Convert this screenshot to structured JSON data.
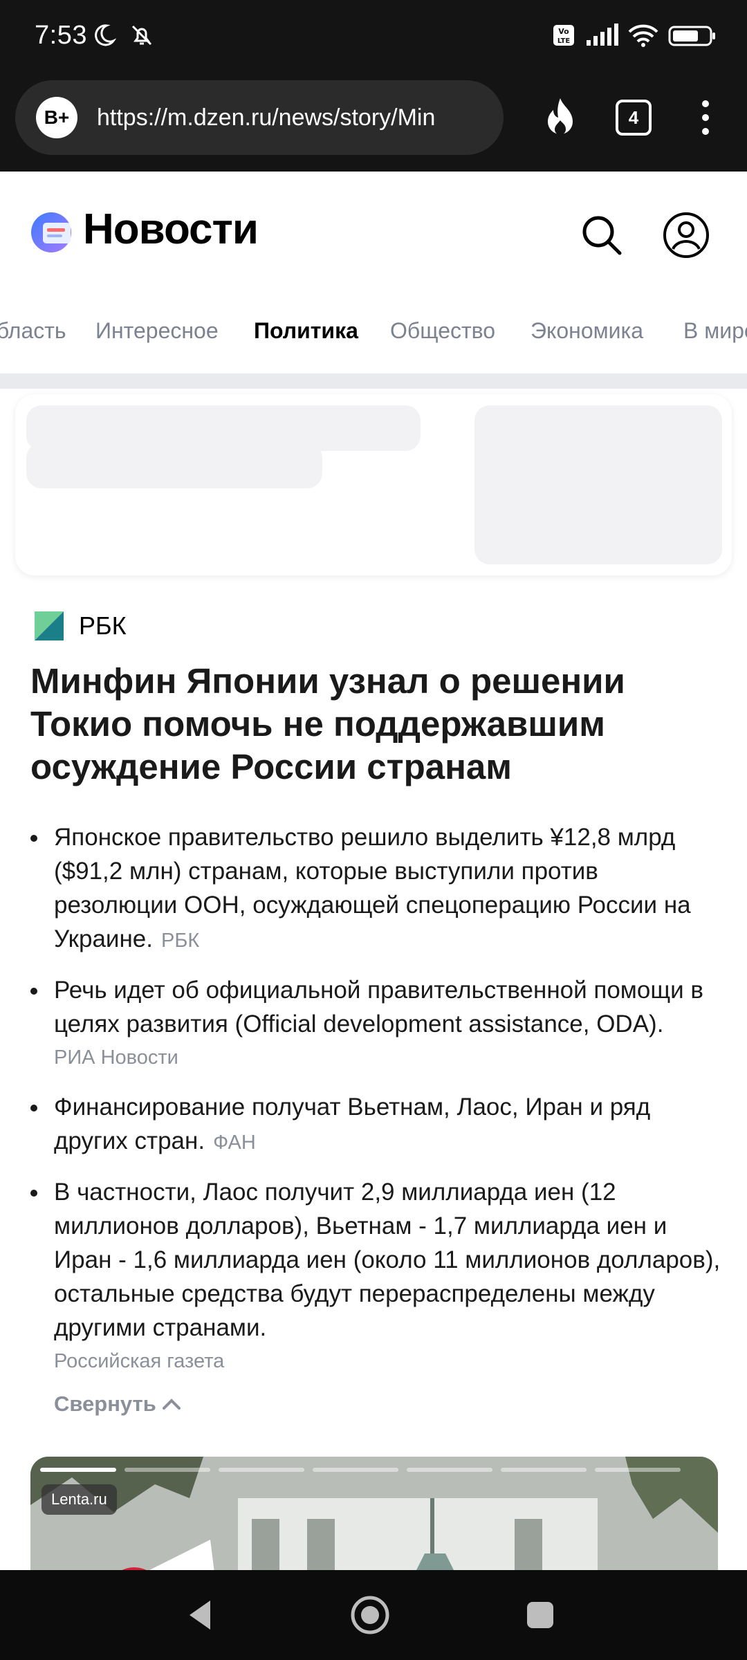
{
  "status_bar": {
    "time": "7:53",
    "icons": [
      "moon-icon",
      "bell-off-icon",
      "volte-icon",
      "signal-icon",
      "wifi-icon",
      "battery-icon"
    ]
  },
  "browser": {
    "profile_badge": "B+",
    "url": "https://m.dzen.ru/news/story/Min",
    "tab_count": "4"
  },
  "header": {
    "title": "Новости"
  },
  "tabs": [
    {
      "label": "Область",
      "active": false
    },
    {
      "label": "Интересное",
      "active": false
    },
    {
      "label": "Политика",
      "active": true
    },
    {
      "label": "Общество",
      "active": false
    },
    {
      "label": "Экономика",
      "active": false
    },
    {
      "label": "В мире",
      "active": false
    }
  ],
  "article": {
    "source": "РБК",
    "headline": "Минфин Японии узнал о решении Токио помочь не поддержавшим осуждение России странам",
    "bullets": [
      {
        "text": "Японское правительство решило выделить ¥12,8 млрд ($91,2 млн) странам, которые выступили против резолюции ООН, осуждающей спецоперацию России на Украине.",
        "source": "РБК"
      },
      {
        "text": "Речь идет об официальной правительственной помощи в целях развития (Official development assistance, ODA).",
        "source": "РИА Новости"
      },
      {
        "text": "Финансирование получат Вьетнам, Лаос, Иран и ряд других стран.",
        "source": "ФАН"
      },
      {
        "text": "В частности, Лаос получит 2,9 миллиарда иен (12 миллионов долларов), Вьетнам - 1,7 миллиарда иен и Иран - 1,6 миллиарда иен (около 11 миллионов долларов), остальные средства будут перераспределены между другими странами.",
        "source": "Российская газета"
      }
    ],
    "collapse_label": "Свернуть"
  },
  "story": {
    "badge": "Lenta.ru"
  },
  "colors": {
    "accent_blue": "#5b8cff",
    "muted_text": "#8a8f99",
    "source_green": "#2f9e8f"
  }
}
